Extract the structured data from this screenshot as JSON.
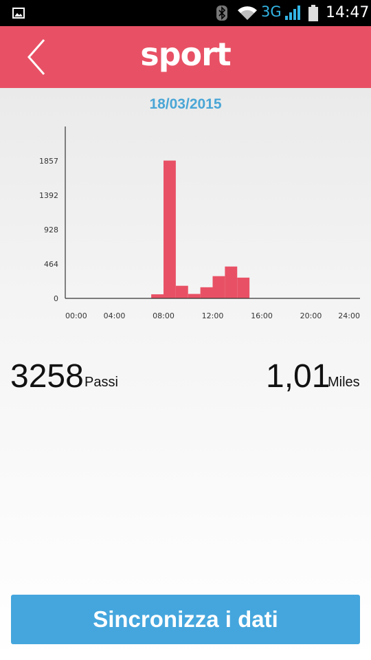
{
  "status_bar": {
    "network": "3G",
    "time": "14:47",
    "icons": [
      "image-icon",
      "bluetooth-icon",
      "wifi-icon",
      "signal-icon",
      "battery-icon"
    ]
  },
  "header": {
    "title": "sport",
    "back_icon": "chevron-left-icon",
    "color": "#e85165"
  },
  "date": "18/03/2015",
  "chart_data": {
    "type": "bar",
    "title": "",
    "xlabel": "",
    "ylabel": "",
    "x_ticks": [
      "00:00",
      "04:00",
      "08:00",
      "12:00",
      "16:00",
      "20:00",
      "24:00"
    ],
    "y_ticks": [
      "0",
      "464",
      "928",
      "1392",
      "1857"
    ],
    "xlim": [
      0,
      24
    ],
    "ylim": [
      0,
      2320
    ],
    "hours": [
      7,
      8,
      9,
      10,
      11,
      12,
      13,
      14
    ],
    "values": [
      55,
      1860,
      170,
      60,
      150,
      300,
      430,
      280
    ],
    "bar_color": "#e85165"
  },
  "stats": {
    "steps_value": "3258",
    "steps_unit": "Passi",
    "distance_value": "1,01",
    "distance_unit": "Miles"
  },
  "sync_button": {
    "label": "Sincronizza i dati",
    "color": "#45a6dd"
  }
}
